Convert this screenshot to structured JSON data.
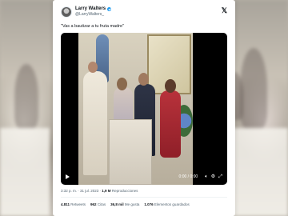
{
  "tweet": {
    "display_name": "Larry Walters",
    "handle": "@LarryWalters_",
    "text": "\"Vas a bautizar a tu fruta madre\"",
    "time": "3:32 p. m.",
    "date": "31 jul. 2023",
    "views_count": "1,9 M",
    "views_label": "Reproducciones",
    "x_logo": "𝕏"
  },
  "video": {
    "time_display": "0:00 / 0:00",
    "progress": 0
  },
  "stats": {
    "retweets_count": "4.811",
    "retweets_label": "Retweets",
    "quotes_count": "962",
    "quotes_label": "Citas",
    "likes_count": "36,8 mil",
    "likes_label": "Me gusta",
    "bookmarks_count": "1.076",
    "bookmarks_label": "Elementos guardados"
  },
  "colors": {
    "verified": "#1d9bf0",
    "text": "#0f1419",
    "muted": "#536471"
  }
}
